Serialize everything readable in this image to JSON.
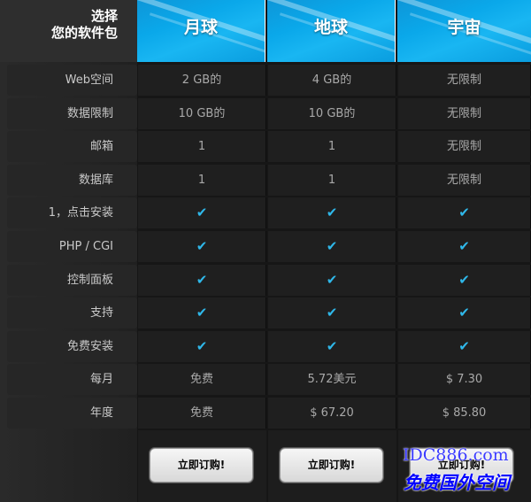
{
  "header": {
    "choose_line1": "选择",
    "choose_line2": "您的软件包",
    "plans": [
      "月球",
      "地球",
      "宇宙"
    ]
  },
  "rows": [
    {
      "label": "Web空间",
      "values": [
        "2 GB的",
        "4 GB的",
        "无限制"
      ]
    },
    {
      "label": "数据限制",
      "values": [
        "10 GB的",
        "10 GB的",
        "无限制"
      ]
    },
    {
      "label": "邮箱",
      "values": [
        "1",
        "1",
        "无限制"
      ]
    },
    {
      "label": "数据库",
      "values": [
        "1",
        "1",
        "无限制"
      ]
    },
    {
      "label": "1，点击安装",
      "values": [
        "✔",
        "✔",
        "✔"
      ]
    },
    {
      "label": "PHP / CGI",
      "values": [
        "✔",
        "✔",
        "✔"
      ]
    },
    {
      "label": "控制面板",
      "values": [
        "✔",
        "✔",
        "✔"
      ]
    },
    {
      "label": "支持",
      "values": [
        "✔",
        "✔",
        "✔"
      ]
    },
    {
      "label": "免费安装",
      "values": [
        "✔",
        "✔",
        "✔"
      ]
    },
    {
      "label": "每月",
      "values": [
        "免费",
        "5.72美元",
        "$ 7.30"
      ]
    },
    {
      "label": "年度",
      "values": [
        "免费",
        "$ 67.20",
        "$ 85.80"
      ]
    }
  ],
  "footer": {
    "order_label": "立即订购!"
  },
  "watermark": {
    "line1": "IDC886.com",
    "line2": "免费国外空间"
  },
  "colors": {
    "accent": "#0aa8ea",
    "check": "#2fb8ea"
  }
}
